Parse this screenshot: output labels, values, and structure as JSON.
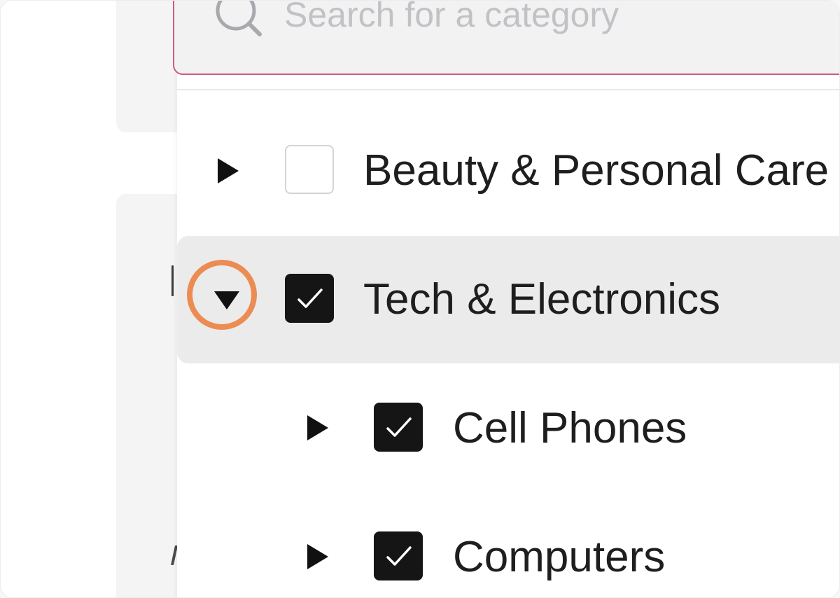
{
  "search": {
    "placeholder": "Search for a category",
    "value": ""
  },
  "categories": [
    {
      "label": "Beauty & Personal Care",
      "expanded": false,
      "checked": false,
      "level": 0
    },
    {
      "label": "Tech & Electronics",
      "expanded": true,
      "checked": true,
      "level": 0,
      "highlighted": true
    },
    {
      "label": "Cell Phones",
      "expanded": false,
      "checked": true,
      "level": 1
    },
    {
      "label": "Computers",
      "expanded": false,
      "checked": true,
      "level": 1
    }
  ],
  "colors": {
    "focus_border": "#cf5b7b",
    "annotation_ring": "#ec8c52",
    "checkbox_checked": "#151515",
    "row_highlight": "#ebebec"
  },
  "icons": {
    "search": "search-icon",
    "collapsed": "caret-right-icon",
    "expanded": "caret-down-icon",
    "check": "checkmark-icon"
  }
}
